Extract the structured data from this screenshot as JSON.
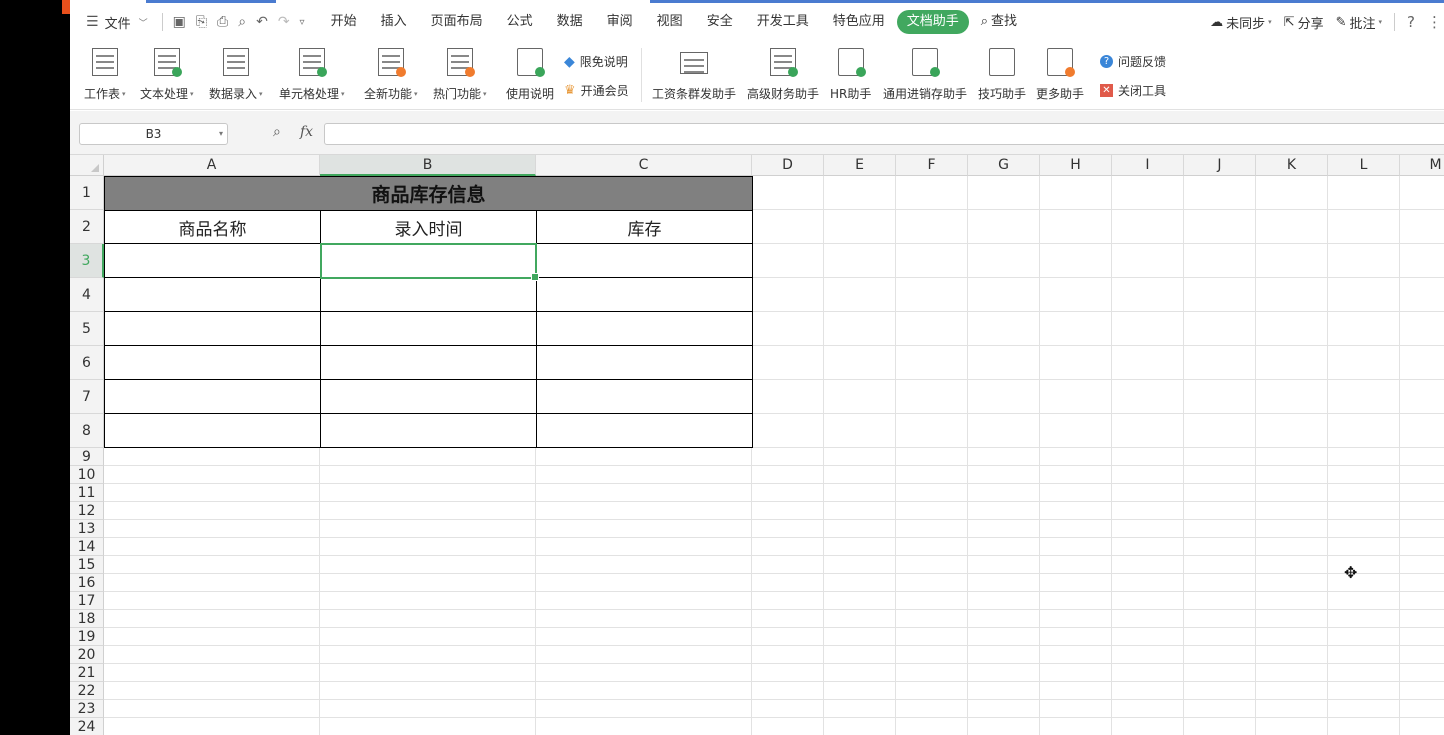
{
  "menubar": {
    "file_label": "文件",
    "tabs": [
      "开始",
      "插入",
      "页面布局",
      "公式",
      "数据",
      "审阅",
      "视图",
      "安全",
      "开发工具",
      "特色应用",
      "文档助手"
    ],
    "active_tab": "文档助手",
    "search_label": "查找",
    "sync_label": "未同步",
    "share_label": "分享",
    "comment_label": "批注",
    "help_label": "?"
  },
  "ribbon": {
    "worksheet": "工作表",
    "text_process": "文本处理",
    "data_entry": "数据录入",
    "cell_process": "单元格处理",
    "new_features": "全新功能",
    "hot_features": "热门功能",
    "usage_guide": "使用说明",
    "disclaimer": "限免说明",
    "open_member": "开通会员",
    "payroll_helper": "工资条群发助手",
    "finance_helper": "高级财务助手",
    "hr_helper": "HR助手",
    "inventory_helper": "通用进销存助手",
    "tips_helper": "技巧助手",
    "more_helpers": "更多助手",
    "feedback": "问题反馈",
    "close_tools": "关闭工具"
  },
  "formula": {
    "cell_ref": "B3",
    "fx": "fx",
    "value": ""
  },
  "sheet": {
    "columns": [
      "A",
      "B",
      "C",
      "D",
      "E",
      "F",
      "G",
      "H",
      "I",
      "J",
      "K",
      "L",
      "M"
    ],
    "selected_column": "B",
    "rows": [
      "1",
      "2",
      "3",
      "4",
      "5",
      "6",
      "7",
      "8",
      "9",
      "10",
      "11",
      "12",
      "13",
      "14",
      "15",
      "16",
      "17",
      "18",
      "19",
      "20",
      "21",
      "22",
      "23",
      "24"
    ],
    "selected_row": "3",
    "table_title": "商品库存信息",
    "headers": [
      "商品名称",
      "录入时间",
      "库存"
    ],
    "active_cell": "B3"
  },
  "colors": {
    "accent": "#41a85f",
    "title_fill": "#808080"
  }
}
